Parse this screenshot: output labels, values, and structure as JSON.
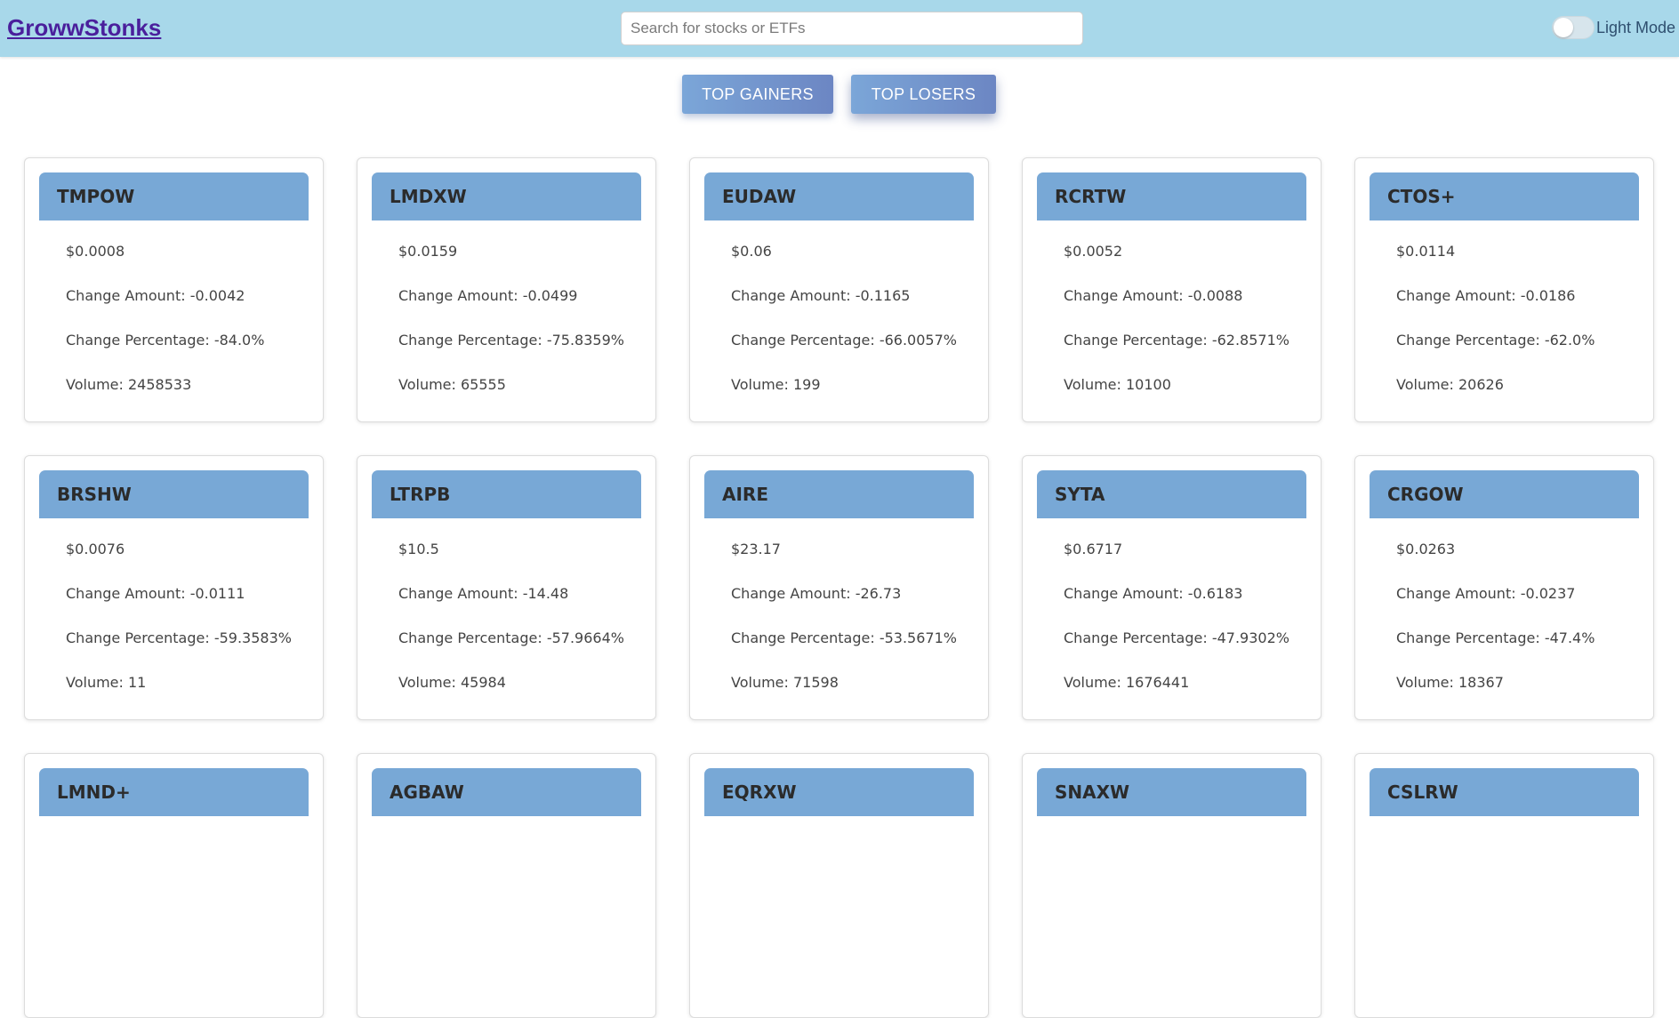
{
  "header": {
    "logo": "GrowwStonks",
    "search_placeholder": "Search for stocks or ETFs",
    "theme_label": "Light Mode"
  },
  "tabs": {
    "gainers": "TOP GAINERS",
    "losers": "TOP LOSERS"
  },
  "labels": {
    "change_amount": "Change Amount: ",
    "change_percentage": "Change Percentage: ",
    "volume": "Volume: "
  },
  "stocks": [
    {
      "ticker": "TMPOW",
      "price": "$0.0008",
      "change_amount": "-0.0042",
      "change_percentage": "-84.0%",
      "volume": "2458533"
    },
    {
      "ticker": "LMDXW",
      "price": "$0.0159",
      "change_amount": "-0.0499",
      "change_percentage": "-75.8359%",
      "volume": "65555"
    },
    {
      "ticker": "EUDAW",
      "price": "$0.06",
      "change_amount": "-0.1165",
      "change_percentage": "-66.0057%",
      "volume": "199"
    },
    {
      "ticker": "RCRTW",
      "price": "$0.0052",
      "change_amount": "-0.0088",
      "change_percentage": "-62.8571%",
      "volume": "10100"
    },
    {
      "ticker": "CTOS+",
      "price": "$0.0114",
      "change_amount": "-0.0186",
      "change_percentage": "-62.0%",
      "volume": "20626"
    },
    {
      "ticker": "BRSHW",
      "price": "$0.0076",
      "change_amount": "-0.0111",
      "change_percentage": "-59.3583%",
      "volume": "11"
    },
    {
      "ticker": "LTRPB",
      "price": "$10.5",
      "change_amount": "-14.48",
      "change_percentage": "-57.9664%",
      "volume": "45984"
    },
    {
      "ticker": "AIRE",
      "price": "$23.17",
      "change_amount": "-26.73",
      "change_percentage": "-53.5671%",
      "volume": "71598"
    },
    {
      "ticker": "SYTA",
      "price": "$0.6717",
      "change_amount": "-0.6183",
      "change_percentage": "-47.9302%",
      "volume": "1676441"
    },
    {
      "ticker": "CRGOW",
      "price": "$0.0263",
      "change_amount": "-0.0237",
      "change_percentage": "-47.4%",
      "volume": "18367"
    },
    {
      "ticker": "LMND+"
    },
    {
      "ticker": "AGBAW"
    },
    {
      "ticker": "EQRXW"
    },
    {
      "ticker": "SNAXW"
    },
    {
      "ticker": "CSLRW"
    }
  ]
}
